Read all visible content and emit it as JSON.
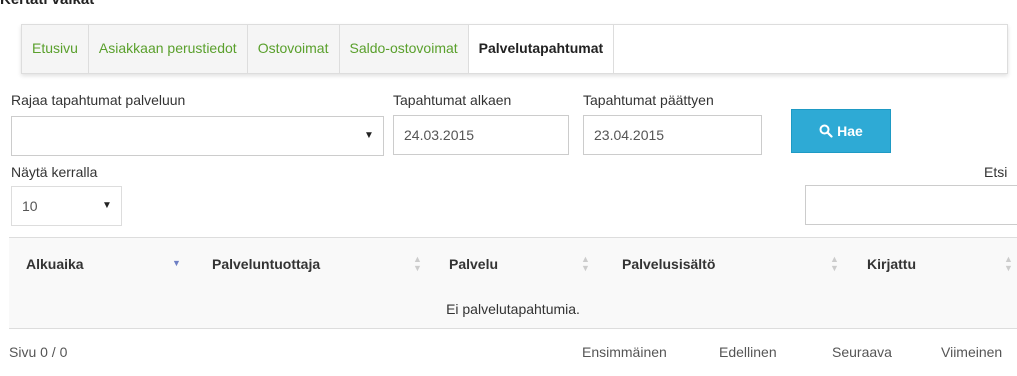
{
  "page_header_fragment": "Kertati valkat",
  "tabs": [
    {
      "label": "Etusivu"
    },
    {
      "label": "Asiakkaan perustiedot"
    },
    {
      "label": "Ostovoimat"
    },
    {
      "label": "Saldo-ostovoimat"
    },
    {
      "label": "Palvelutapahtumat",
      "active": true
    }
  ],
  "filters": {
    "service_label": "Rajaa tapahtumat palveluun",
    "service_value": "",
    "start_label": "Tapahtumat alkaen",
    "start_value": "24.03.2015",
    "end_label": "Tapahtumat päättyen",
    "end_value": "23.04.2015",
    "search_button": "Hae",
    "search_icon": "search-icon"
  },
  "page_size": {
    "label": "Näytä kerralla",
    "value": "10"
  },
  "search": {
    "label": "Etsi",
    "value": ""
  },
  "table": {
    "columns": [
      "Alkuaika",
      "Palveluntuottaja",
      "Palvelu",
      "Palvelusisältö",
      "Kirjattu"
    ],
    "sorted_column": "Alkuaika",
    "empty_message": "Ei palvelutapahtumia."
  },
  "pagination": {
    "page_info": "Sivu 0 / 0",
    "first": "Ensimmäinen",
    "previous": "Edellinen",
    "next": "Seuraava",
    "last": "Viimeinen"
  },
  "colors": {
    "tab_text": "#5aa02c",
    "button": "#2eaad5",
    "sort_active": "#6e7fc4"
  }
}
